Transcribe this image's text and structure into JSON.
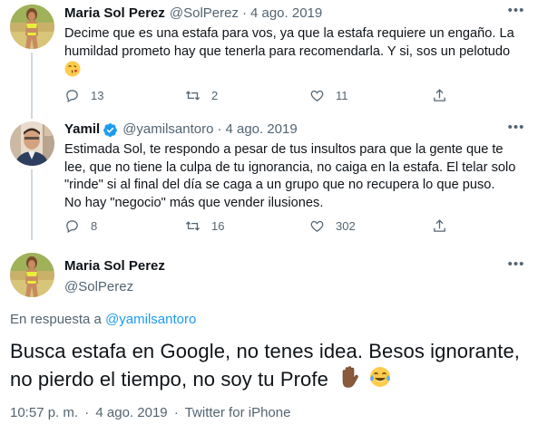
{
  "tweet1": {
    "name": "Maria Sol Perez",
    "handle": "@SolPerez",
    "separator": "·",
    "time": "4 ago. 2019",
    "line1": "Decime que es una estafa para vos, ya que la estafa requiere un engaño. La",
    "line2": "humildad prometo hay que tenerla para recomendarla. Y si, sos un pelotudo",
    "emoji": "face-blowing-kiss",
    "replies": "13",
    "retweets": "2",
    "likes": "11"
  },
  "tweet2": {
    "name": "Yamil",
    "handle": "@yamilsantoro",
    "separator": "·",
    "time": "4 ago. 2019",
    "verified": true,
    "line1": "Estimada Sol, te respondo a pesar de tus insultos para que la gente que te",
    "line2": "lee, que no tiene la culpa de tu ignorancia, no caiga en la estafa. El telar solo",
    "line3": "\"rinde\" si al final del día se caga a un grupo que no recupera lo que puso.",
    "line4": "No hay \"negocio\" más que vender ilusiones.",
    "replies": "8",
    "retweets": "16",
    "likes": "302"
  },
  "main_tweet": {
    "name": "Maria Sol Perez",
    "handle": "@SolPerez",
    "reply_prefix": "En respuesta a",
    "reply_to": "@yamilsantoro",
    "line1": "Busca estafa en Google, no tenes idea. Besos ignorante,",
    "line2": "no pierdo el tiempo, no soy tu Profe",
    "emojis": [
      "raised-hand-dark-skin",
      "face-with-tears-of-joy"
    ],
    "time": "10:57 p. m.",
    "separator": "·",
    "date": "4 ago. 2019",
    "source": "Twitter for iPhone"
  },
  "colors": {
    "text": "#0f1419",
    "secondary": "#536471",
    "link": "#1d9bf0",
    "line": "#cfd9de"
  }
}
